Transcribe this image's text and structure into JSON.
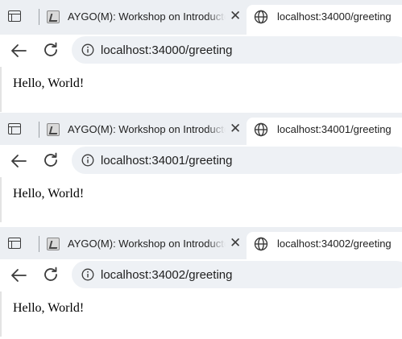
{
  "windows": [
    {
      "tabs": {
        "inactive_title": "AYGO(M): Workshop on Introductory",
        "close_glyph": "✕",
        "active_title": "localhost:34000/greeting"
      },
      "address_bar": {
        "url": "localhost:34000/greeting"
      },
      "page": {
        "text": "Hello, World!"
      }
    },
    {
      "tabs": {
        "inactive_title": "AYGO(M): Workshop on Introductory",
        "close_glyph": "✕",
        "active_title": "localhost:34001/greeting"
      },
      "address_bar": {
        "url": "localhost:34001/greeting"
      },
      "page": {
        "text": "Hello, World!"
      }
    },
    {
      "tabs": {
        "inactive_title": "AYGO(M): Workshop on Introductory",
        "close_glyph": "✕",
        "active_title": "localhost:34002/greeting"
      },
      "address_bar": {
        "url": "localhost:34002/greeting"
      },
      "page": {
        "text": "Hello, World!"
      }
    }
  ],
  "icons": {
    "tab_overview": "tab-overview-icon",
    "site_favicon": "site-favicon-icon",
    "globe": "globe-icon",
    "back": "back-arrow-icon",
    "reload": "reload-icon",
    "info": "info-icon"
  },
  "colors": {
    "tabstrip_bg": "#eceff3",
    "omnibox_bg": "#eef1f5",
    "icon": "#3b3b3b"
  }
}
